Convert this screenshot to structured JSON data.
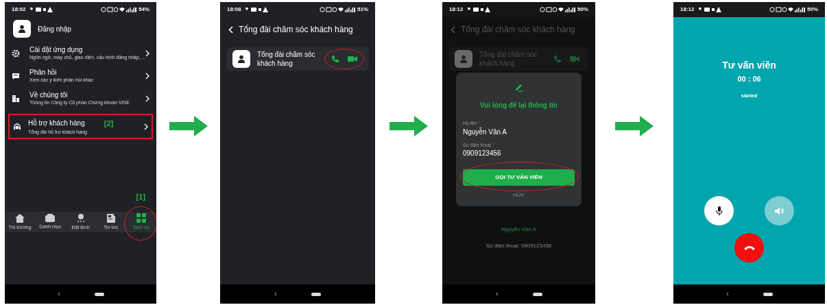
{
  "screens": [
    {
      "kind": "settings",
      "status_bar": {
        "time": "18:02",
        "battery": "54%"
      },
      "login": "Đăng nhập",
      "menu": [
        {
          "kind": "gear",
          "title": "Cài đặt ứng dụng",
          "subtitle": "Ngôn ngữ, máy chủ, giao diện, cấu hình đăng nhập, ...",
          "highlighted": false
        },
        {
          "kind": "chat",
          "title": "Phản hồi",
          "subtitle": "Xem các ý kiến phản hồi khác",
          "highlighted": false
        },
        {
          "kind": "building",
          "title": "Về chúng tôi",
          "subtitle": "Thông tin Công ty Cổ phần Chứng khoán VISE",
          "highlighted": false
        },
        {
          "kind": "headset",
          "title": "Hỗ trợ khách hàng",
          "subtitle": "Tổng đài hỗ trợ khách hàng",
          "highlighted": true,
          "callout": "[2]"
        }
      ],
      "callout": "[1]",
      "tabs": [
        {
          "kind": "home",
          "label": "Thị trường",
          "selected": false,
          "highlighted": false
        },
        {
          "kind": "folder",
          "label": "Danh mục",
          "selected": false,
          "highlighted": false
        },
        {
          "kind": "coin",
          "label": "Đặt lệnh",
          "selected": false,
          "highlighted": false
        },
        {
          "kind": "news",
          "label": "Tin tức",
          "selected": false,
          "highlighted": false
        },
        {
          "kind": "grid",
          "label": "Dịch vụ",
          "selected": true,
          "highlighted": true
        }
      ]
    },
    {
      "kind": "contacts",
      "status_bar": {
        "time": "18:08",
        "battery": "51%"
      },
      "title": "Tổng đài chăm sóc khách hàng",
      "contacts": [
        {
          "name": "Tổng đài chăm sóc khách hàng",
          "highlighted": true
        }
      ]
    },
    {
      "kind": "form",
      "status_bar": {
        "time": "18:12",
        "battery": "50%"
      },
      "title": "Tổng đài chăm sóc khách hàng",
      "contact_name": "Tổng đài chăm sóc khách hàng",
      "dialog": {
        "title": "Vui lòng để lại thông tin",
        "fields": [
          {
            "label": "Họ tên",
            "required_mark": "*",
            "value": "Nguyễn Văn A"
          },
          {
            "label": "Số điện thoại",
            "required_mark": "*",
            "value": "0909123456"
          }
        ],
        "primary_button": {
          "label": "GỌI TƯ VẤN VIÊN",
          "highlighted": true
        },
        "cancel_button": "HỦY"
      },
      "background_name": "Nguyễn Văn A",
      "background_phone": "Số điện thoại: 0909123456"
    },
    {
      "kind": "call",
      "status_bar": {
        "time": "18:12",
        "battery": "50%"
      },
      "caller": "Tư vấn viên",
      "duration": "00 : 06",
      "state": "started",
      "controls": [
        {
          "kind": "mic",
          "active": true
        },
        {
          "kind": "speaker",
          "active": false
        }
      ]
    }
  ]
}
